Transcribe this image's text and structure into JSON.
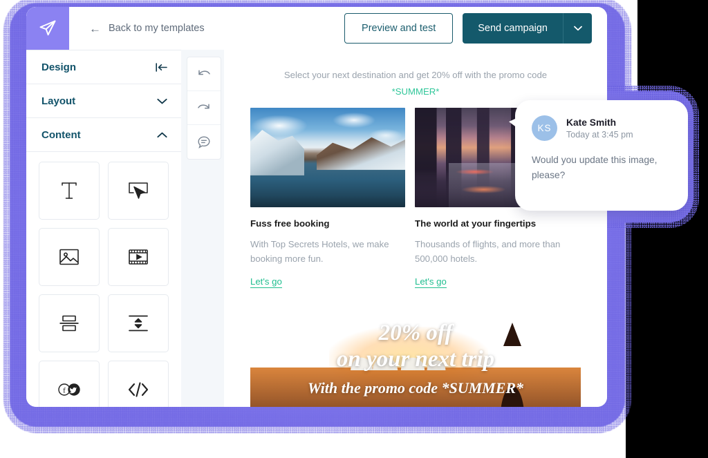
{
  "window": {
    "frame_color": "#7b72e9",
    "logo_color": "#8b82f2",
    "logo_icon": "paper-plane-icon"
  },
  "header": {
    "back_label": "Back to my templates",
    "back_icon": "arrow-left-icon",
    "preview_label": "Preview and test",
    "send_label": "Send campaign",
    "send_caret_icon": "chevron-down-icon",
    "primary_color": "#14596b"
  },
  "sidebar": {
    "sections": [
      {
        "label": "Design",
        "icon": "collapse-panel-icon",
        "state": "active"
      },
      {
        "label": "Layout",
        "icon": "chevron-down-icon",
        "state": "collapsed"
      },
      {
        "label": "Content",
        "icon": "chevron-up-icon",
        "state": "expanded"
      }
    ],
    "blocks": [
      {
        "name": "text-block",
        "icon": "text-t-icon"
      },
      {
        "name": "button-block",
        "icon": "cursor-button-icon"
      },
      {
        "name": "image-block",
        "icon": "image-icon"
      },
      {
        "name": "video-block",
        "icon": "film-strip-icon"
      },
      {
        "name": "columns-block",
        "icon": "split-rows-icon"
      },
      {
        "name": "spacer-block",
        "icon": "spacer-arrows-icon"
      },
      {
        "name": "social-block",
        "icon": "social-follow-icon"
      },
      {
        "name": "html-block",
        "icon": "code-brackets-icon"
      }
    ]
  },
  "tools": [
    {
      "name": "undo-button",
      "icon": "undo-arrow-icon"
    },
    {
      "name": "redo-button",
      "icon": "redo-arrow-icon"
    },
    {
      "name": "comment-button",
      "icon": "comment-bubble-icon"
    }
  ],
  "email": {
    "promo_line": "Select your next destination and get 20% off with the promo code",
    "promo_code": "*SUMMER*",
    "promo_code_color": "#31c79a",
    "columns": [
      {
        "image_name": "glacier-lake-photo",
        "title": "Fuss free booking",
        "body": "With Top Secrets Hotels, we make booking more fun.",
        "link": "Let's go"
      },
      {
        "image_name": "city-skyline-photo",
        "title": "The world at your fingertips",
        "body": "Thousands of flights, and more than 500,000 hotels.",
        "link": "Let's go"
      }
    ],
    "hero": {
      "image_name": "sydney-sunset-photo",
      "line1": "20% off",
      "line2": "on your next trip",
      "line3": "With the promo code *SUMMER*"
    }
  },
  "comment": {
    "avatar_initials": "KS",
    "avatar_color": "#9cc0e8",
    "author": "Kate Smith",
    "timestamp": "Today at 3:45 pm",
    "text": "Would you update this image, please?"
  }
}
